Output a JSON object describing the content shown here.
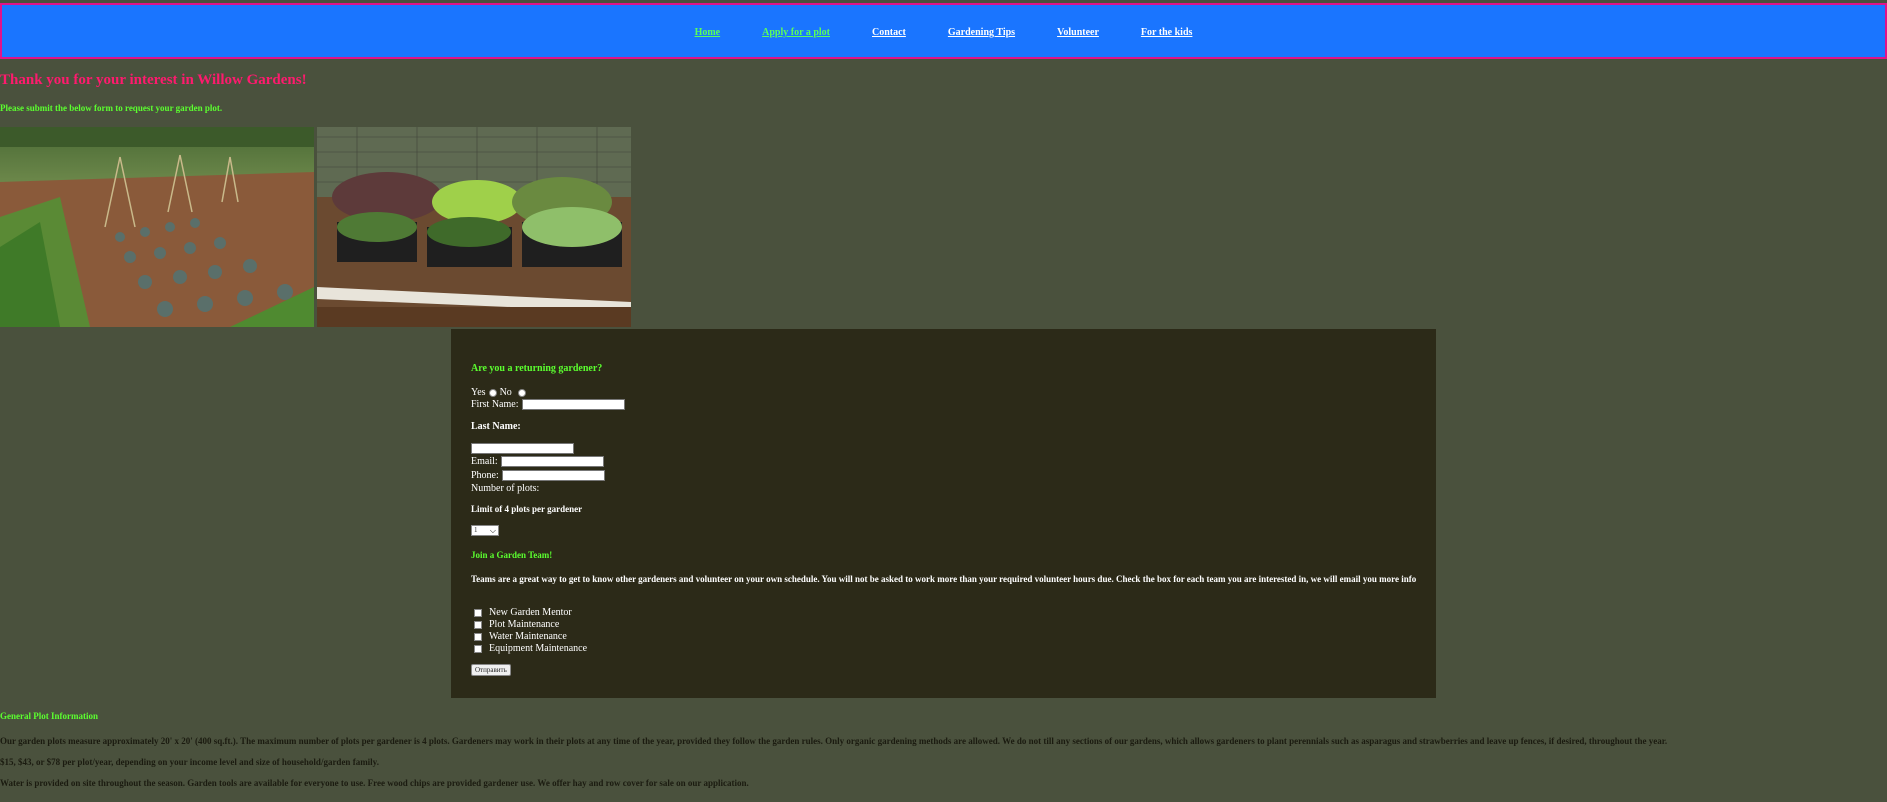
{
  "nav": {
    "items": [
      {
        "label": "Home",
        "state": "visited"
      },
      {
        "label": "Apply for a plot",
        "state": "active"
      },
      {
        "label": "Contact",
        "state": "normal"
      },
      {
        "label": "Gardening Tips",
        "state": "normal"
      },
      {
        "label": "Volunteer",
        "state": "normal"
      },
      {
        "label": "For the kids",
        "state": "normal"
      }
    ]
  },
  "header": {
    "title": "Thank you for your interest in Willow Gardens!",
    "subtitle": "Please submit the below form to request your garden plot."
  },
  "form": {
    "returning_question": "Are you a returning gardener?",
    "yes_label": "Yes",
    "no_label": "No",
    "first_name_label": "First Name:",
    "last_name_label": "Last Name:",
    "email_label": "Email:",
    "phone_label": "Phone:",
    "plots_label": "Number of plots:",
    "plots_limit": "Limit of 4 plots per gardener",
    "plots_selected": "1",
    "team_heading": "Join a Garden Team!",
    "team_text": "Teams are a great way to get to know other gardeners and volunteer on your own schedule. You will not be asked to work more than your required volunteer hours due. Check the box for each team you are interested in, we will email you more info",
    "teams": [
      "New Garden Mentor",
      "Plot Maintenance",
      "Water Maintenance",
      "Equipment Maintenance"
    ],
    "submit_label": "Отправить"
  },
  "info": {
    "heading": "General Plot Information",
    "lines": [
      "Our garden plots measure approximately 20' x 20' (400 sq.ft.). The maximum number of plots per gardener is 4 plots. Gardeners may work in their plots at any time of the year, provided they follow the garden rules. Only organic gardening methods are allowed. We do not till any sections of our gardens, which allows gardeners to plant perennials such as asparagus and strawberries and leave up fences, if desired, throughout the year.",
      "$15, $43, or $78 per plot/year, depending on your income level and size of household/garden family.",
      "Water is provided on site throughout the season. Garden tools are available for everyone to use. Free wood chips are provided gardener use. We offer hay and row cover for sale on our application."
    ]
  },
  "colors": {
    "page_bg": "#4a513d",
    "nav_bg": "#1a75ff",
    "nav_border": "#e0138a",
    "title": "#ff1a6e",
    "accent_green": "#5bff2f",
    "form_bg": "#2c2a18"
  }
}
